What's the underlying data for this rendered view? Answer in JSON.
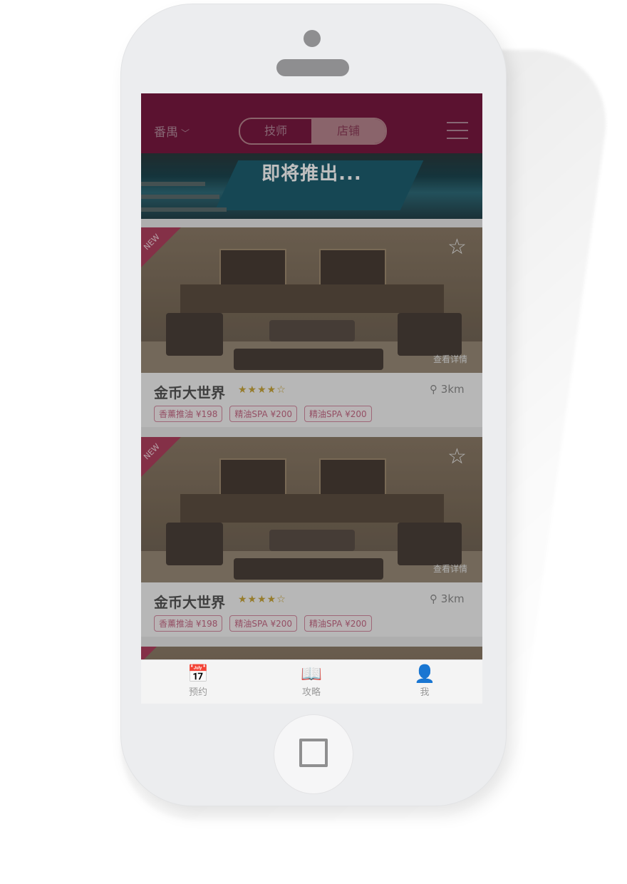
{
  "header": {
    "city": "番禺",
    "segments": [
      "技师",
      "店铺"
    ],
    "active_segment": "店铺",
    "menu_icon": "hamburger-icon"
  },
  "banner": {
    "text": "即将推出...",
    "dots": 3,
    "active_dot": 0
  },
  "cards": [
    {
      "badge": "NEW",
      "favorite_icon": "star-outline-icon",
      "detail_link": "查看详情",
      "name": "金币大世界",
      "rating": 4,
      "rating_max": 5,
      "stars_text": "★★★★☆",
      "distance": "3km",
      "tags": [
        "香薰推油 ¥198",
        "精油SPA ¥200",
        "精油SPA ¥200"
      ]
    },
    {
      "badge": "NEW",
      "favorite_icon": "star-outline-icon",
      "detail_link": "查看详情",
      "name": "金币大世界",
      "rating": 4,
      "rating_max": 5,
      "stars_text": "★★★★☆",
      "distance": "3km",
      "tags": [
        "香薰推油 ¥198",
        "精油SPA ¥200",
        "精油SPA ¥200"
      ]
    }
  ],
  "tabbar": {
    "items": [
      {
        "label": "预约",
        "icon": "calendar-icon"
      },
      {
        "label": "攻略",
        "icon": "book-icon"
      },
      {
        "label": "我",
        "icon": "user-icon"
      }
    ]
  },
  "colors": {
    "header_bg": "#7a1840",
    "accent_pink": "#d0557c",
    "star_gold": "#c9a63a"
  }
}
